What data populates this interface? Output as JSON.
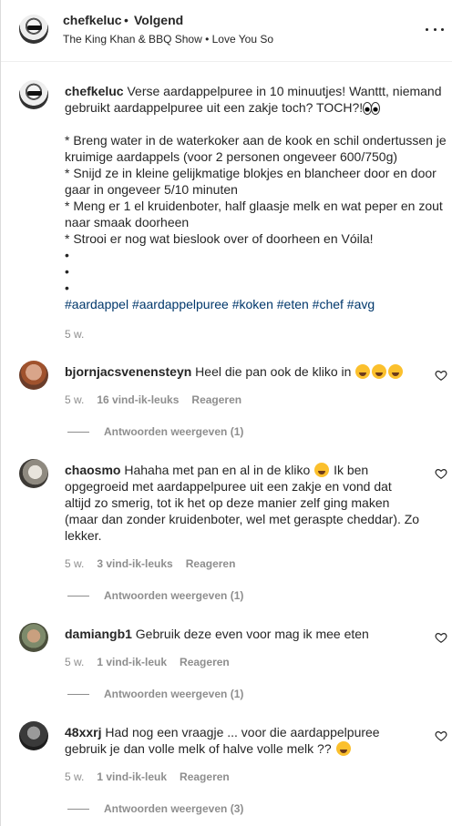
{
  "header": {
    "username": "chefkeluc",
    "separator": "•",
    "follow_status": "Volgend",
    "audio": "The King Khan & BBQ Show • Love You So"
  },
  "caption": {
    "username": "chefkeluc",
    "line1": "Verse aardappelpuree in 10 minuutjes! Wanttt, niemand",
    "line2": "gebruikt aardappelpuree uit een zakje toch? TOCH?!",
    "step1a": "* Breng water in de waterkoker aan de kook en schil ondertussen je",
    "step1b": "kruimige aardappels (voor 2 personen ongeveer 600/750g)",
    "step2a": "* Snijd ze in kleine gelijkmatige blokjes en blancheer door en door",
    "step2b": "gaar in ongeveer 5/10 minuten",
    "step3a": "* Meng er 1 el kruidenboter, half glaasje melk en wat peper en zout",
    "step3b": "naar smaak doorheen",
    "step4": "* Strooi er nog wat bieslook over of doorheen en Vóila!",
    "bullet": "•",
    "hashtags": "#aardappel #aardappelpuree #koken #eten #chef #avg",
    "time": "5 w."
  },
  "comments": [
    {
      "username": "bjornjacsvenensteyn",
      "text": "Heel die pan ook de kliko in",
      "time": "5 w.",
      "likes": "16 vind-ik-leuks",
      "reply": "Reageren",
      "view_replies": "Antwoorden weergeven (1)"
    },
    {
      "username": "chaosmo",
      "text1": "Hahaha met pan en al in de kliko",
      "text2": "Ik ben",
      "text3": "opgegroeid met aardappelpuree uit een zakje en vond dat",
      "text4": "altijd zo smerig, tot ik het op deze manier zelf ging maken",
      "text5": "(maar dan zonder kruidenboter, wel met geraspte cheddar). Zo",
      "text6": "lekker.",
      "time": "5 w.",
      "likes": "3 vind-ik-leuks",
      "reply": "Reageren",
      "view_replies": "Antwoorden weergeven (1)"
    },
    {
      "username": "damiangb1",
      "text": "Gebruik deze even voor mag ik mee eten",
      "time": "5 w.",
      "likes": "1 vind-ik-leuk",
      "reply": "Reageren",
      "view_replies": "Antwoorden weergeven (1)"
    },
    {
      "username": "48xxrj",
      "text1": "Had nog een vraagje ... voor die aardappelpuree",
      "text2": "gebruik je dan volle melk of halve volle melk ??",
      "time": "5 w.",
      "likes": "1 vind-ik-leuk",
      "reply": "Reageren",
      "view_replies": "Antwoorden weergeven (3)"
    }
  ],
  "icons": {
    "more": "more-options-icon",
    "heart": "heart-icon",
    "eyes_emoji": "eyes-emoji-icon",
    "laughing_emoji": "laughing-emoji-icon",
    "wink_emoji": "wink-emoji-icon"
  }
}
